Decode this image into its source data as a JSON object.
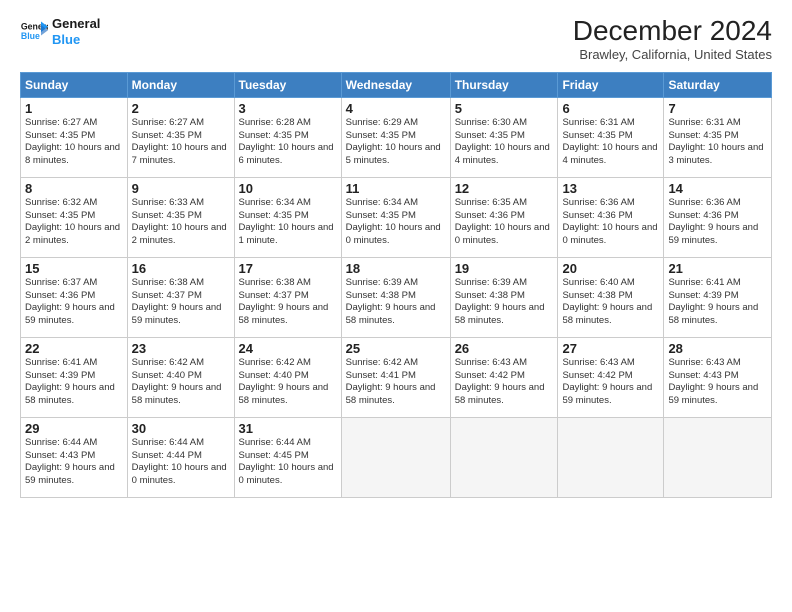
{
  "logo": {
    "line1": "General",
    "line2": "Blue"
  },
  "title": "December 2024",
  "subtitle": "Brawley, California, United States",
  "headers": [
    "Sunday",
    "Monday",
    "Tuesday",
    "Wednesday",
    "Thursday",
    "Friday",
    "Saturday"
  ],
  "weeks": [
    [
      {
        "day": "1",
        "sunrise": "6:27 AM",
        "sunset": "4:35 PM",
        "daylight": "10 hours and 8 minutes."
      },
      {
        "day": "2",
        "sunrise": "6:27 AM",
        "sunset": "4:35 PM",
        "daylight": "10 hours and 7 minutes."
      },
      {
        "day": "3",
        "sunrise": "6:28 AM",
        "sunset": "4:35 PM",
        "daylight": "10 hours and 6 minutes."
      },
      {
        "day": "4",
        "sunrise": "6:29 AM",
        "sunset": "4:35 PM",
        "daylight": "10 hours and 5 minutes."
      },
      {
        "day": "5",
        "sunrise": "6:30 AM",
        "sunset": "4:35 PM",
        "daylight": "10 hours and 4 minutes."
      },
      {
        "day": "6",
        "sunrise": "6:31 AM",
        "sunset": "4:35 PM",
        "daylight": "10 hours and 4 minutes."
      },
      {
        "day": "7",
        "sunrise": "6:31 AM",
        "sunset": "4:35 PM",
        "daylight": "10 hours and 3 minutes."
      }
    ],
    [
      {
        "day": "8",
        "sunrise": "6:32 AM",
        "sunset": "4:35 PM",
        "daylight": "10 hours and 2 minutes."
      },
      {
        "day": "9",
        "sunrise": "6:33 AM",
        "sunset": "4:35 PM",
        "daylight": "10 hours and 2 minutes."
      },
      {
        "day": "10",
        "sunrise": "6:34 AM",
        "sunset": "4:35 PM",
        "daylight": "10 hours and 1 minute."
      },
      {
        "day": "11",
        "sunrise": "6:34 AM",
        "sunset": "4:35 PM",
        "daylight": "10 hours and 0 minutes."
      },
      {
        "day": "12",
        "sunrise": "6:35 AM",
        "sunset": "4:36 PM",
        "daylight": "10 hours and 0 minutes."
      },
      {
        "day": "13",
        "sunrise": "6:36 AM",
        "sunset": "4:36 PM",
        "daylight": "10 hours and 0 minutes."
      },
      {
        "day": "14",
        "sunrise": "6:36 AM",
        "sunset": "4:36 PM",
        "daylight": "9 hours and 59 minutes."
      }
    ],
    [
      {
        "day": "15",
        "sunrise": "6:37 AM",
        "sunset": "4:36 PM",
        "daylight": "9 hours and 59 minutes."
      },
      {
        "day": "16",
        "sunrise": "6:38 AM",
        "sunset": "4:37 PM",
        "daylight": "9 hours and 59 minutes."
      },
      {
        "day": "17",
        "sunrise": "6:38 AM",
        "sunset": "4:37 PM",
        "daylight": "9 hours and 58 minutes."
      },
      {
        "day": "18",
        "sunrise": "6:39 AM",
        "sunset": "4:38 PM",
        "daylight": "9 hours and 58 minutes."
      },
      {
        "day": "19",
        "sunrise": "6:39 AM",
        "sunset": "4:38 PM",
        "daylight": "9 hours and 58 minutes."
      },
      {
        "day": "20",
        "sunrise": "6:40 AM",
        "sunset": "4:38 PM",
        "daylight": "9 hours and 58 minutes."
      },
      {
        "day": "21",
        "sunrise": "6:41 AM",
        "sunset": "4:39 PM",
        "daylight": "9 hours and 58 minutes."
      }
    ],
    [
      {
        "day": "22",
        "sunrise": "6:41 AM",
        "sunset": "4:39 PM",
        "daylight": "9 hours and 58 minutes."
      },
      {
        "day": "23",
        "sunrise": "6:42 AM",
        "sunset": "4:40 PM",
        "daylight": "9 hours and 58 minutes."
      },
      {
        "day": "24",
        "sunrise": "6:42 AM",
        "sunset": "4:40 PM",
        "daylight": "9 hours and 58 minutes."
      },
      {
        "day": "25",
        "sunrise": "6:42 AM",
        "sunset": "4:41 PM",
        "daylight": "9 hours and 58 minutes."
      },
      {
        "day": "26",
        "sunrise": "6:43 AM",
        "sunset": "4:42 PM",
        "daylight": "9 hours and 58 minutes."
      },
      {
        "day": "27",
        "sunrise": "6:43 AM",
        "sunset": "4:42 PM",
        "daylight": "9 hours and 59 minutes."
      },
      {
        "day": "28",
        "sunrise": "6:43 AM",
        "sunset": "4:43 PM",
        "daylight": "9 hours and 59 minutes."
      }
    ],
    [
      {
        "day": "29",
        "sunrise": "6:44 AM",
        "sunset": "4:43 PM",
        "daylight": "9 hours and 59 minutes."
      },
      {
        "day": "30",
        "sunrise": "6:44 AM",
        "sunset": "4:44 PM",
        "daylight": "10 hours and 0 minutes."
      },
      {
        "day": "31",
        "sunrise": "6:44 AM",
        "sunset": "4:45 PM",
        "daylight": "10 hours and 0 minutes."
      },
      null,
      null,
      null,
      null
    ]
  ],
  "labels": {
    "sunrise": "Sunrise:",
    "sunset": "Sunset:",
    "daylight": "Daylight:"
  }
}
